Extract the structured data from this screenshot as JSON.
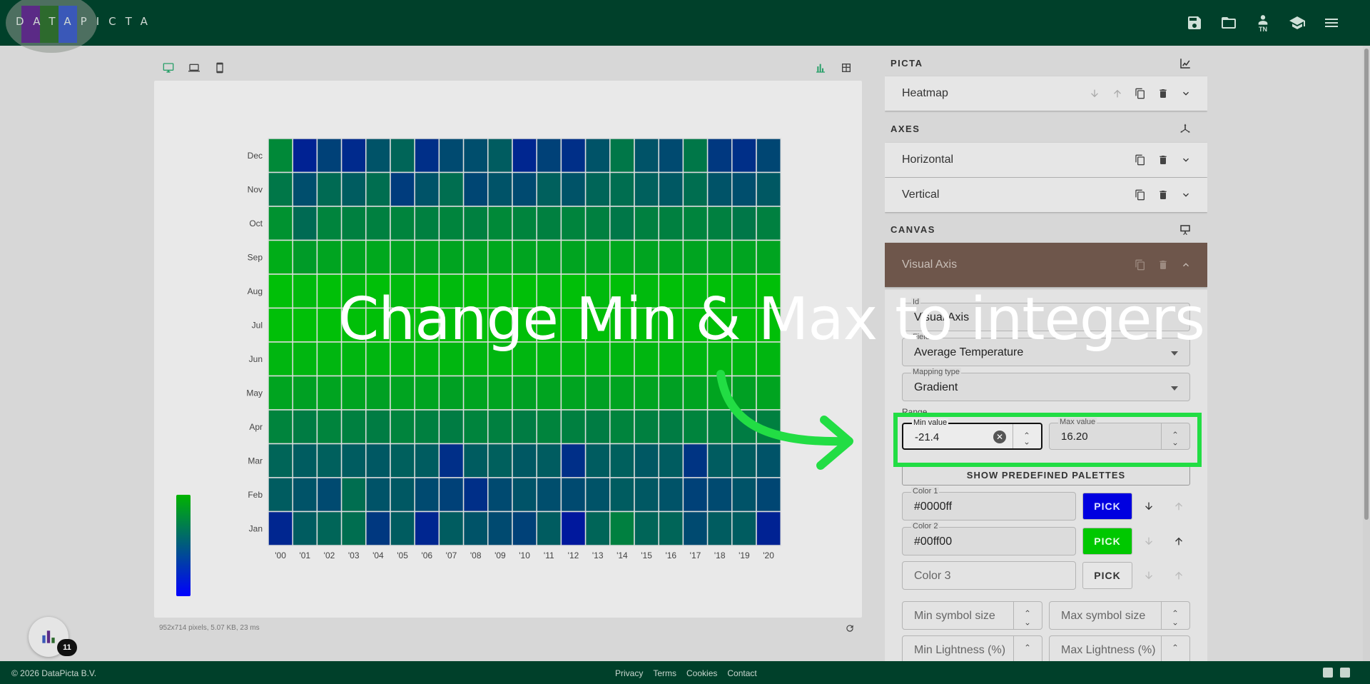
{
  "app": {
    "logo_text": "DATAPICTA",
    "logo_colors": [
      "#5b2a86",
      "#2d6a2d",
      "#3a58b8"
    ]
  },
  "header": {
    "icons": [
      "save-icon",
      "folder-open-icon",
      "user-icon",
      "graduation-cap-icon",
      "menu-icon"
    ],
    "user_initials": "TN"
  },
  "preview": {
    "device_icons": [
      "desktop-icon",
      "laptop-icon",
      "mobile-icon"
    ],
    "view_icons": [
      "chart-view-icon",
      "table-view-icon"
    ],
    "status": "952x714 pixels, 5.07 KB, 23 ms"
  },
  "panel": {
    "sections": {
      "picta": "PICTA",
      "axes": "AXES",
      "canvas": "CANVAS"
    },
    "picta_items": [
      "Heatmap"
    ],
    "axes_items": [
      "Horizontal",
      "Vertical"
    ],
    "canvas_items": [
      "Visual Axis"
    ],
    "visual_axis": {
      "id_label": "Id",
      "id_value": "Visual Axis",
      "field_label": "Field",
      "field_value": "Average Temperature",
      "mapping_label": "Mapping type",
      "mapping_value": "Gradient",
      "range_label": "Range",
      "min_label": "Min value",
      "min_value": "-21.4",
      "max_label": "Max value",
      "max_value": "16.20",
      "palettes_button": "SHOW PREDEFINED PALETTES",
      "color1_label": "Color 1",
      "color1_value": "#0000ff",
      "color2_label": "Color 2",
      "color2_value": "#00ff00",
      "color3_placeholder": "Color 3",
      "pick_label": "PICK",
      "min_symbol": "Min symbol size",
      "max_symbol": "Max symbol size",
      "min_light": "Min Lightness (%)",
      "max_light": "Max Lightness (%)"
    }
  },
  "footer": {
    "copyright": "© 2026 DataPicta B.V.",
    "links": [
      "Privacy",
      "Terms",
      "Cookies",
      "Contact"
    ]
  },
  "fab": {
    "count": "11"
  },
  "tutorial": {
    "caption": "Change Min & Max to integers",
    "highlight_color": "#22dd44"
  },
  "chart_data": {
    "type": "heatmap",
    "x": [
      "'00",
      "'01",
      "'02",
      "'03",
      "'04",
      "'05",
      "'06",
      "'07",
      "'08",
      "'09",
      "'10",
      "'11",
      "'12",
      "'13",
      "'14",
      "'15",
      "'16",
      "'17",
      "'18",
      "'19",
      "'20"
    ],
    "y": [
      "Dec",
      "Nov",
      "Oct",
      "Sep",
      "Aug",
      "Jul",
      "Jun",
      "May",
      "Apr",
      "Mar",
      "Feb",
      "Jan"
    ],
    "values": [
      [
        0.65,
        0.08,
        0.25,
        0.12,
        0.35,
        0.45,
        0.15,
        0.3,
        0.32,
        0.4,
        0.1,
        0.25,
        0.15,
        0.35,
        0.55,
        0.35,
        0.3,
        0.55,
        0.2,
        0.15,
        0.28
      ],
      [
        0.55,
        0.32,
        0.48,
        0.4,
        0.5,
        0.22,
        0.35,
        0.5,
        0.28,
        0.35,
        0.3,
        0.42,
        0.35,
        0.45,
        0.5,
        0.42,
        0.38,
        0.5,
        0.35,
        0.32,
        0.38
      ],
      [
        0.7,
        0.48,
        0.62,
        0.6,
        0.6,
        0.62,
        0.6,
        0.62,
        0.6,
        0.65,
        0.62,
        0.6,
        0.62,
        0.6,
        0.55,
        0.6,
        0.6,
        0.62,
        0.6,
        0.55,
        0.6
      ],
      [
        0.85,
        0.75,
        0.8,
        0.8,
        0.82,
        0.8,
        0.8,
        0.8,
        0.8,
        0.82,
        0.8,
        0.8,
        0.8,
        0.8,
        0.82,
        0.8,
        0.8,
        0.8,
        0.8,
        0.8,
        0.8
      ],
      [
        0.95,
        0.92,
        0.95,
        0.92,
        0.95,
        0.92,
        0.95,
        0.92,
        0.95,
        0.92,
        0.95,
        0.92,
        0.95,
        0.92,
        0.95,
        0.92,
        0.95,
        0.92,
        0.95,
        0.92,
        0.95
      ],
      [
        0.95,
        0.95,
        0.95,
        0.95,
        0.95,
        0.95,
        0.95,
        0.95,
        0.95,
        0.95,
        0.95,
        0.95,
        0.95,
        0.95,
        0.95,
        0.95,
        0.95,
        0.95,
        0.95,
        0.95,
        0.95
      ],
      [
        0.9,
        0.9,
        0.9,
        0.9,
        0.9,
        0.9,
        0.9,
        0.9,
        0.9,
        0.9,
        0.9,
        0.9,
        0.9,
        0.9,
        0.9,
        0.9,
        0.9,
        0.9,
        0.9,
        0.9,
        0.9
      ],
      [
        0.8,
        0.78,
        0.8,
        0.8,
        0.78,
        0.8,
        0.8,
        0.78,
        0.8,
        0.8,
        0.78,
        0.8,
        0.8,
        0.78,
        0.8,
        0.8,
        0.78,
        0.8,
        0.8,
        0.78,
        0.8
      ],
      [
        0.62,
        0.58,
        0.62,
        0.6,
        0.58,
        0.62,
        0.6,
        0.58,
        0.62,
        0.6,
        0.58,
        0.62,
        0.6,
        0.58,
        0.62,
        0.6,
        0.58,
        0.62,
        0.6,
        0.58,
        0.6
      ],
      [
        0.45,
        0.4,
        0.42,
        0.4,
        0.38,
        0.42,
        0.4,
        0.15,
        0.4,
        0.42,
        0.38,
        0.4,
        0.15,
        0.4,
        0.42,
        0.38,
        0.4,
        0.18,
        0.4,
        0.4,
        0.35
      ],
      [
        0.4,
        0.35,
        0.3,
        0.5,
        0.35,
        0.38,
        0.3,
        0.25,
        0.15,
        0.3,
        0.35,
        0.32,
        0.3,
        0.35,
        0.4,
        0.38,
        0.35,
        0.25,
        0.3,
        0.35,
        0.28
      ],
      [
        0.1,
        0.4,
        0.45,
        0.5,
        0.2,
        0.4,
        0.1,
        0.4,
        0.35,
        0.3,
        0.25,
        0.4,
        0.02,
        0.45,
        0.6,
        0.45,
        0.45,
        0.3,
        0.4,
        0.4,
        0.08
      ]
    ],
    "color_scale": [
      "#0000ff",
      "#00ff00"
    ],
    "legend": "bottom-left gradient bar"
  }
}
